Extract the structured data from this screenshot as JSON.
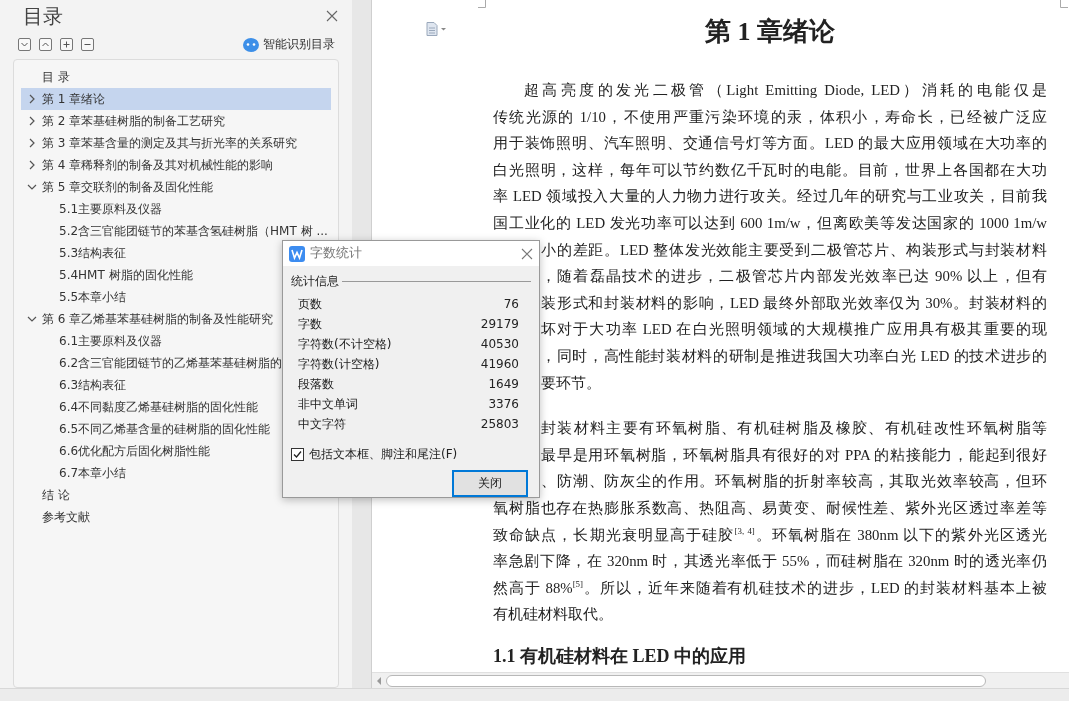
{
  "toc_panel": {
    "title": "目录",
    "smart_button": "智能识别目录",
    "items": [
      {
        "label": "目 录",
        "selected": false
      },
      {
        "label": "第 1 章绪论",
        "selected": true,
        "expanded": false
      },
      {
        "label": "第 2 章苯基硅树脂的制备工艺研究",
        "selected": false,
        "expanded": false
      },
      {
        "label": "第 3 章苯基含量的测定及其与折光率的关系研究",
        "selected": false,
        "expanded": false
      },
      {
        "label": "第 4 章稀释剂的制备及其对机械性能的影响",
        "selected": false,
        "expanded": false
      },
      {
        "label": "第 5 章交联剂的制备及固化性能",
        "selected": false,
        "expanded": true,
        "children": [
          {
            "label": "5.1主要原料及仪器",
            "selected": false
          },
          {
            "label": "5.2含三官能团链节的苯基含氢硅树脂（HMT 树 ...",
            "selected": false
          },
          {
            "label": "5.3结构表征",
            "selected": false
          },
          {
            "label": "5.4HMT 树脂的固化性能",
            "selected": false
          },
          {
            "label": "5.5本章小结",
            "selected": false
          }
        ]
      },
      {
        "label": "第 6 章乙烯基苯基硅树脂的制备及性能研究",
        "selected": false,
        "expanded": true,
        "children": [
          {
            "label": "6.1主要原料及仪器",
            "selected": false
          },
          {
            "label": "6.2含三官能团链节的乙烯基苯基硅树脂的",
            "selected": false
          },
          {
            "label": "6.3结构表征",
            "selected": false
          },
          {
            "label": "6.4不同黏度乙烯基硅树脂的固化性能",
            "selected": false
          },
          {
            "label": "6.5不同乙烯基含量的硅树脂的固化性能",
            "selected": false
          },
          {
            "label": "6.6优化配方后固化树脂性能",
            "selected": false
          },
          {
            "label": "6.7本章小结",
            "selected": false
          }
        ]
      },
      {
        "label": "结 论",
        "selected": false
      },
      {
        "label": "参考文献",
        "selected": false
      }
    ]
  },
  "document": {
    "title": "第 1 章绪论",
    "heading": "1.1  有机硅材料在 LED 中的应用",
    "lines": [
      {
        "kind": "first",
        "text": "超高亮度的发光二极管（Light  Emitting  Diode,  LED）消耗的电能仅是"
      },
      {
        "kind": "full",
        "text": "传统光源的 1/10，不使用严重污染环境的汞，体积小，寿命长，已经被广泛应"
      },
      {
        "kind": "full",
        "text": "用于装饰照明、汽车照明、交通信号灯等方面。LED 的最大应用领域在大功率的"
      },
      {
        "kind": "full",
        "text": "白光照明，这样，每年可以节约数亿千瓦时的电能。目前，世界上各国都在大功"
      },
      {
        "kind": "full",
        "text": "率 LED 领域投入大量的人力物力进行攻关。经过几年的研究与工业攻关，目前我"
      },
      {
        "kind": "full",
        "text": "国工业化的 LED 发光功率可以达到 600 1m/w，但离欧美等发达国家的 1000 1m/w"
      },
      {
        "kind": "covered",
        "text": "小的差距。LED 整体发光效能主要受到二极管芯片、构装形式与封装材料"
      },
      {
        "kind": "covered",
        "text": "，随着磊晶技术的进步，二极管芯片内部发光效率已达 90% 以上，但有"
      },
      {
        "kind": "covered",
        "text": "装形式和封装材料的影响，LED 最终外部取光效率仅为 30%。封装材料的"
      },
      {
        "kind": "covered",
        "text": "坏对于大功率 LED 在白光照明领域的大规模推广应用具有极其重要的现"
      },
      {
        "kind": "covered",
        "text": "，同时，高性能封装材料的研制是推进我国大功率白光 LED 的技术进步的"
      },
      {
        "kind": "covered_last",
        "text": "要环节。"
      },
      {
        "kind": "gap"
      },
      {
        "kind": "covered",
        "text": "封装材料主要有环氧树脂、有机硅树脂及橡胶、有机硅改性环氧树脂等"
      },
      {
        "kind": "covered",
        "text": "最早是用环氧树脂，环氧树脂具有很好的对 PPA 的粘接能力，能起到很好"
      },
      {
        "kind": "covered",
        "text": "、防潮、防灰尘的作用。环氧树脂的折射率较高，其取光效率较高，但环"
      },
      {
        "kind": "full",
        "text": "氧树脂也存在热膨胀系数高、热阻高、易黄变、耐候性差、紫外光区透过率差等"
      },
      {
        "kind": "full",
        "text": "致命缺点，长期光衰明显高于硅胶$^{[3, 4]}$。环氧树脂在 380nm 以下的紫外光区透光"
      },
      {
        "kind": "full",
        "text": "率急剧下降，在 320nm 时，其透光率低于 55%，而硅树脂在 320nm 时的透光率仍"
      },
      {
        "kind": "full",
        "text": "然高于 88%$^{[5]}$。所以，近年来随着有机硅技术的进步，LED 的封装材料基本上被"
      },
      {
        "kind": "last",
        "text": "有机硅材料取代。"
      }
    ]
  },
  "dialog": {
    "title": "字数统计",
    "group": "统计信息",
    "stats": [
      {
        "label": "页数",
        "value": "76"
      },
      {
        "label": "字数",
        "value": "29179"
      },
      {
        "label": "字符数(不计空格)",
        "value": "40530"
      },
      {
        "label": "字符数(计空格)",
        "value": "41960"
      },
      {
        "label": "段落数",
        "value": "1649"
      },
      {
        "label": "非中文单词",
        "value": "3376"
      },
      {
        "label": "中文字符",
        "value": "25803"
      }
    ],
    "checkbox": {
      "label": "包括文本框、脚注和尾注(F)",
      "checked": true
    },
    "button": "关闭"
  }
}
